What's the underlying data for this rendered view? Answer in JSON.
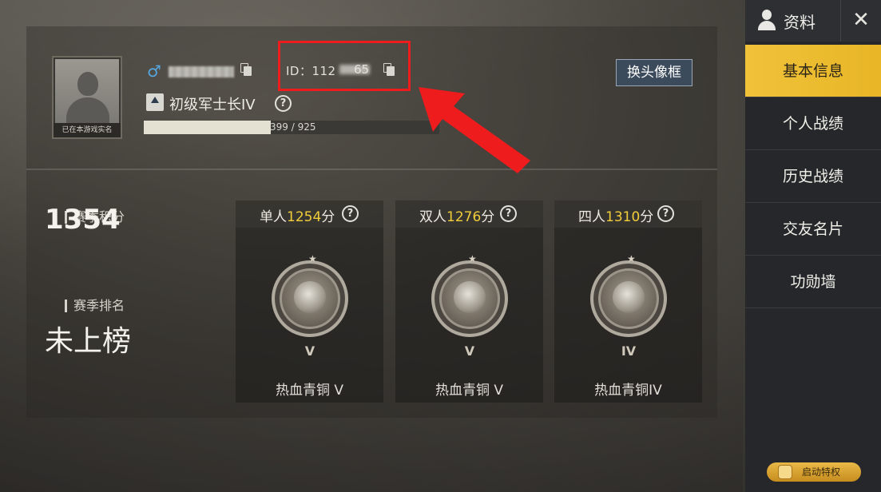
{
  "profile": {
    "avatar_caption": "已在本游戏实名",
    "gender_symbol": "♂",
    "id_prefix": "ID：112",
    "id_suffix": "65",
    "change_frame_label": "换头像框",
    "rank_name": "初级军士长IV",
    "help_symbol": "?",
    "xp_text": "399 / 925",
    "xp_progress": 0.431
  },
  "season": {
    "score_label": "赛季积分",
    "score_value": "1354",
    "rank_label": "赛季排名",
    "rank_value": "未上榜"
  },
  "modes": [
    {
      "name": "单人",
      "score": "1254",
      "unit": "分",
      "tier_numeral": "V",
      "tier_name": "热血青铜 V"
    },
    {
      "name": "双人",
      "score": "1276",
      "unit": "分",
      "tier_numeral": "V",
      "tier_name": "热血青铜 V"
    },
    {
      "name": "四人",
      "score": "1310",
      "unit": "分",
      "tier_numeral": "IV",
      "tier_name": "热血青铜IV"
    }
  ],
  "sidebar": {
    "title": "资料",
    "close_symbol": "✕",
    "items": [
      {
        "label": "基本信息",
        "active": true
      },
      {
        "label": "个人战绩",
        "active": false
      },
      {
        "label": "历史战绩",
        "active": false
      },
      {
        "label": "交友名片",
        "active": false
      },
      {
        "label": "功勋墙",
        "active": false
      }
    ],
    "privilege_label": "启动特权"
  },
  "colors": {
    "accent_yellow": "#f0c23a",
    "highlight_red": "#ee1c1c",
    "score_yellow": "#f2cd3a"
  }
}
